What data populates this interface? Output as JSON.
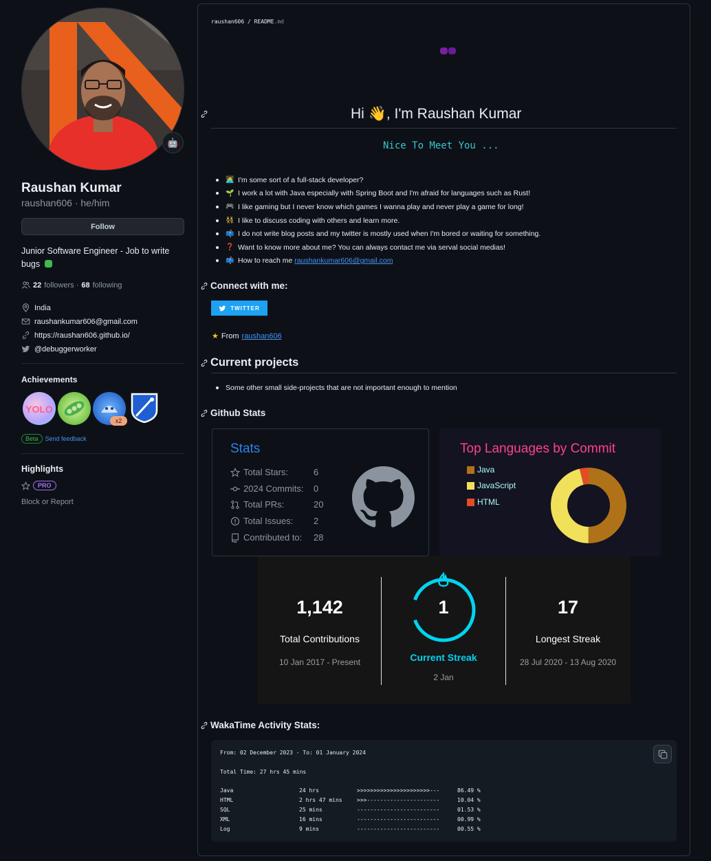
{
  "profile": {
    "full_name": "Raushan Kumar",
    "login_line": "raushan606 · he/him",
    "follow_label": "Follow",
    "bio": "Junior Software Engineer - Job to write bugs",
    "bio_emoji": "bug-icon",
    "followers_count": "22",
    "followers_label": "followers ·",
    "following_count": "68",
    "following_label": "following",
    "location": "India",
    "email": "raushankumar606@gmail.com",
    "website": "https://raushan606.github.io/",
    "twitter": "@debuggerworker"
  },
  "achievements": {
    "title": "Achievements",
    "badges": [
      "yolo",
      "pair-extraordinaire",
      "pull-shark",
      "starstruck"
    ],
    "multiplier": "x2",
    "beta_label": "Beta",
    "feedback_label": "Send feedback"
  },
  "highlights": {
    "title": "Highlights",
    "pro_label": "PRO",
    "block_report": "Block or Report"
  },
  "readme": {
    "path_user": "raushan606",
    "path_sep": " / ",
    "path_file": "README",
    "path_ext": ".md",
    "heading": "Hi 👋, I'm Raushan Kumar",
    "nice_to_meet": "Nice To Meet You ...",
    "about": [
      {
        "emoji": "🧑‍💻",
        "text": "I'm some sort of a full-stack developer?"
      },
      {
        "emoji": "🌱",
        "text": "I work a lot with Java especially with Spring Boot and I'm afraid for languages such as Rust!"
      },
      {
        "emoji": "🎮",
        "text": "I like gaming but I never know which games I wanna play and never play a game for long!"
      },
      {
        "emoji": "👯",
        "text": "I like to discuss coding with others and learn more."
      },
      {
        "emoji": "📫",
        "text": "I do not write blog posts and my twitter is mostly used when I'm bored or waiting for something."
      },
      {
        "emoji": "❓",
        "text": "Want to know more about me? You can always contact me via serval social medias!"
      },
      {
        "emoji": "📫",
        "text": "How to reach me "
      }
    ],
    "reach_email": "raushankumar606@gmail.com",
    "connect_heading": "Connect with me:",
    "twitter_btn": "TWITTER",
    "from_label": "From",
    "from_link": "raushan606",
    "projects_heading": "Current projects",
    "projects": [
      "Some other small side-projects that are not important enough to mention"
    ],
    "github_stats_heading": "Github Stats",
    "waka_heading": "WakaTime Activity Stats:"
  },
  "stats_card": {
    "title": "Stats",
    "rows": [
      {
        "label": "Total Stars:",
        "value": "6",
        "icon": "star-icon"
      },
      {
        "label": "2024 Commits:",
        "value": "0",
        "icon": "commit-icon"
      },
      {
        "label": "Total PRs:",
        "value": "20",
        "icon": "pull-request-icon"
      },
      {
        "label": "Total Issues:",
        "value": "2",
        "icon": "issue-icon"
      },
      {
        "label": "Contributed to:",
        "value": "28",
        "icon": "repo-icon"
      }
    ]
  },
  "languages_card": {
    "title": "Top Languages by Commit",
    "items": [
      {
        "name": "Java",
        "color": "#b07219"
      },
      {
        "name": "JavaScript",
        "color": "#f1e05a"
      },
      {
        "name": "HTML",
        "color": "#e34c26"
      }
    ]
  },
  "chart_data": {
    "type": "pie",
    "title": "Top Languages by Commit",
    "categories": [
      "Java",
      "JavaScript",
      "HTML"
    ],
    "values": [
      50,
      46,
      4
    ],
    "colors": [
      "#b07219",
      "#f1e05a",
      "#e34c26"
    ]
  },
  "streak_card": {
    "total_value": "1,142",
    "total_label": "Total Contributions",
    "total_range": "10 Jan 2017 - Present",
    "current_value": "1",
    "current_label": "Current Streak",
    "current_range": "2 Jan",
    "longest_value": "17",
    "longest_label": "Longest Streak",
    "longest_range": "28 Jul 2020 - 13 Aug 2020"
  },
  "wakatime": {
    "range": "From: 02 December 2023 - To: 01 January 2024",
    "total": "Total Time: 27 hrs 45 mins",
    "rows": [
      {
        "lang": "Java",
        "time": "24 hrs",
        "bar": ">>>>>>>>>>>>>>>>>>>>>>---",
        "pct": "86.49 %"
      },
      {
        "lang": "HTML",
        "time": "2 hrs 47 mins",
        "bar": ">>>----------------------",
        "pct": "10.04 %"
      },
      {
        "lang": "SQL",
        "time": "25 mins",
        "bar": "-------------------------",
        "pct": "01.53 %"
      },
      {
        "lang": "XML",
        "time": "16 mins",
        "bar": "-------------------------",
        "pct": "00.99 %"
      },
      {
        "lang": "Log",
        "time": "9 mins",
        "bar": "-------------------------",
        "pct": "00.55 %"
      }
    ]
  }
}
